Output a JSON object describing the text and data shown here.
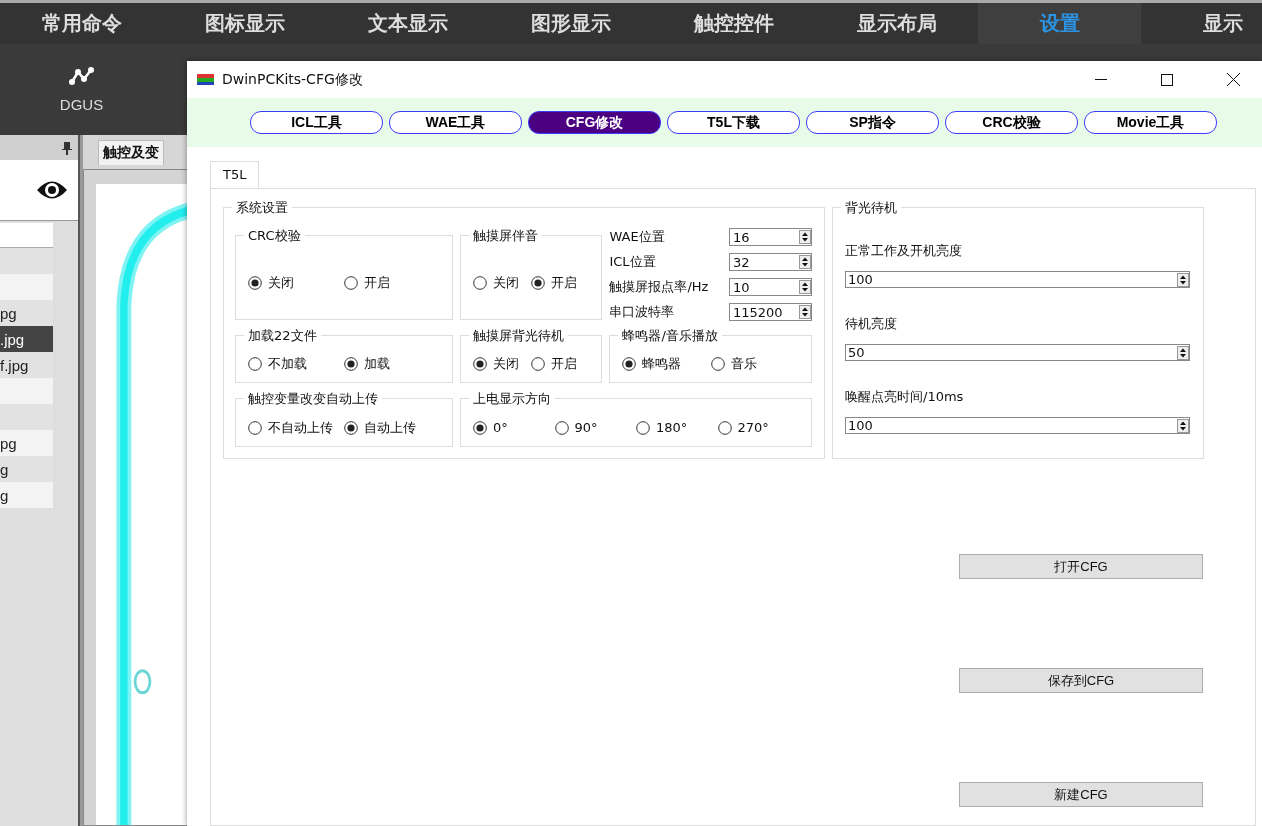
{
  "menu": [
    {
      "label": "常用命令",
      "selected": false
    },
    {
      "label": "图标显示",
      "selected": false
    },
    {
      "label": "文本显示",
      "selected": false
    },
    {
      "label": "图形显示",
      "selected": false
    },
    {
      "label": "触控控件",
      "selected": false
    },
    {
      "label": "显示布局",
      "selected": false
    },
    {
      "label": "设置",
      "selected": true
    },
    {
      "label": "显示",
      "selected": false
    }
  ],
  "toolbar": [
    {
      "label": "DGUS"
    }
  ],
  "file_list": [
    {
      "selected": false
    },
    {
      "selected": false
    },
    {
      "label": "pg",
      "selected": false
    },
    {
      "label": ".jpg",
      "selected": true
    },
    {
      "label": "f.jpg",
      "selected": false
    },
    {
      "selected": false
    },
    {
      "selected": false
    },
    {
      "label": "pg",
      "selected": false
    },
    {
      "label": "g",
      "selected": false
    },
    {
      "label": "g",
      "selected": false
    }
  ],
  "editor_tab": {
    "label": "触控及变"
  },
  "dialog": {
    "title": "DwinPCKits-CFG修改",
    "tools": [
      {
        "label": "ICL工具",
        "selected": false
      },
      {
        "label": "WAE工具",
        "selected": false
      },
      {
        "label": "CFG修改",
        "selected": true
      },
      {
        "label": "T5L下载",
        "selected": false
      },
      {
        "label": "SP指令",
        "selected": false
      },
      {
        "label": "CRC校验",
        "selected": false
      },
      {
        "label": "Movie工具",
        "selected": false
      }
    ],
    "tabs": [
      {
        "label": "T5L",
        "selected": true
      }
    ],
    "system_settings": {
      "title": "系统设置",
      "rows": [
        [
          {
            "kind": "radio-group",
            "title": "CRC校验",
            "options": [
              {
                "label": "关闭",
                "selected": true
              },
              {
                "label": "开启",
                "selected": false
              }
            ]
          },
          {
            "kind": "radio-group",
            "title": "触摸屏伴音",
            "options": [
              {
                "label": "关闭",
                "selected": false
              },
              {
                "label": "开启",
                "selected": true
              }
            ]
          },
          {
            "kind": "spin-list",
            "fields": [
              {
                "label": "WAE位置",
                "value": "16"
              },
              {
                "label": "ICL位置",
                "value": "32"
              },
              {
                "label": "触摸屏报点率/Hz",
                "value": "10"
              },
              {
                "label": "串口波特率",
                "value": "115200"
              }
            ]
          }
        ],
        [
          {
            "kind": "radio-group",
            "title": "加载22文件",
            "options": [
              {
                "label": "不加载",
                "selected": false
              },
              {
                "label": "加载",
                "selected": true
              }
            ]
          },
          {
            "kind": "radio-group",
            "title": "触摸屏背光待机",
            "options": [
              {
                "label": "关闭",
                "selected": true
              },
              {
                "label": "开启",
                "selected": false
              }
            ]
          },
          {
            "kind": "radio-group",
            "title": "蜂鸣器/音乐播放",
            "options": [
              {
                "label": "蜂鸣器",
                "selected": true
              },
              {
                "label": "音乐",
                "selected": false
              }
            ]
          }
        ],
        [
          {
            "kind": "radio-group",
            "title": "触控变量改变自动上传",
            "options": [
              {
                "label": "不自动上传",
                "selected": false
              },
              {
                "label": "自动上传",
                "selected": true
              }
            ]
          },
          {
            "kind": "radio-group",
            "title": "上电显示方向",
            "options": [
              {
                "label": "0°",
                "selected": true
              },
              {
                "label": "90°",
                "selected": false
              },
              {
                "label": "180°",
                "selected": false
              },
              {
                "label": "270°",
                "selected": false
              }
            ]
          }
        ]
      ]
    },
    "backlight": {
      "title": "背光待机",
      "fields": [
        {
          "label": "正常工作及开机亮度",
          "value": "100"
        },
        {
          "label": "待机亮度",
          "value": "50"
        },
        {
          "label": "唤醒点亮时间/10ms",
          "value": "100"
        }
      ]
    },
    "buttons": [
      "打开CFG",
      "保存到CFG",
      "新建CFG"
    ]
  }
}
